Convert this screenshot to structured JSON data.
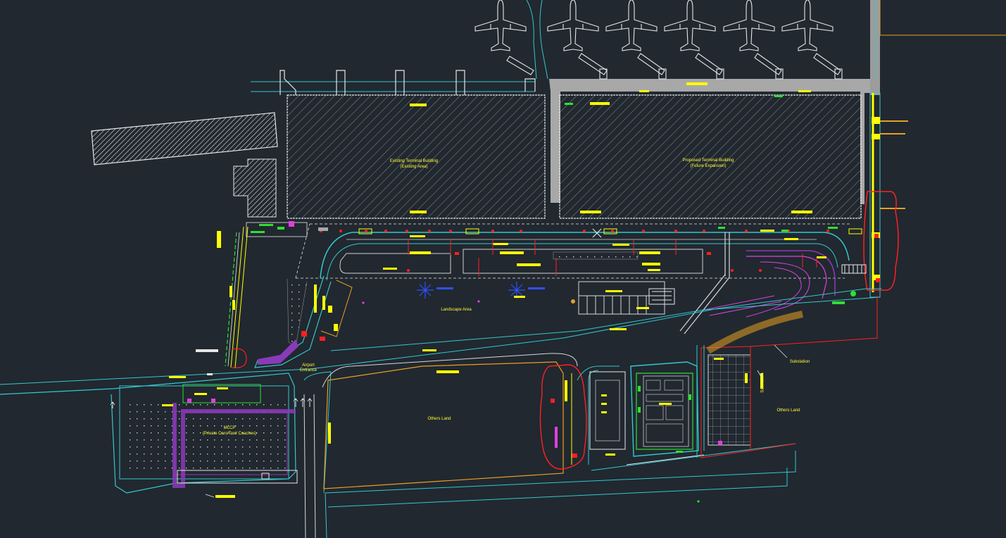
{
  "drawing": {
    "background": "#212830",
    "colors": {
      "white": "#e6e6e6",
      "cyan": "#33c8cc",
      "yellow": "#ffff00",
      "red": "#ff2020",
      "orange": "#e8a020",
      "magenta": "#e040e0",
      "green": "#30e030",
      "blue": "#3050ff",
      "grey": "#9a9a9a",
      "purple": "#8a3ab8"
    }
  },
  "labels": {
    "existing_terminal": "Existing Terminal Building",
    "existing_terminal_sub": "(Existing Area)",
    "proposed_terminal": "Proposed Terminal Building",
    "proposed_terminal_sub": "(Future Expansion)",
    "landscape_area": "Landscape Area",
    "airport_entrance": "Airport\nEntrance",
    "mlcp": "MLCP",
    "mlcp_sub": "(Private Cars/Taxi/ Coaches)",
    "others_land_1": "Others Land",
    "others_land_2": "Others Land",
    "side_label_1": "Substation",
    "side_label_2": "Substation"
  }
}
